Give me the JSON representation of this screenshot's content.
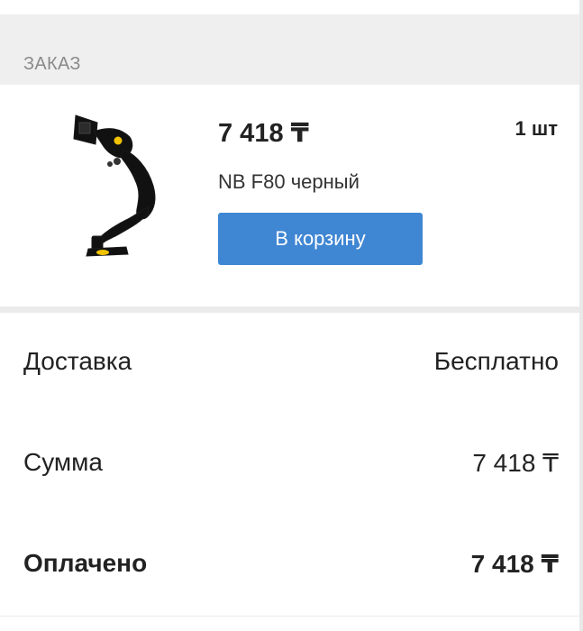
{
  "order": {
    "section_title": "ЗАКАЗ"
  },
  "product": {
    "price": "7 418 ₸",
    "quantity": "1 шт",
    "name": "NB F80 черный",
    "image_icon": "monitor-arm",
    "cart_button_label": "В корзину",
    "button_color": "#3f86d3"
  },
  "summary": {
    "delivery": {
      "label": "Доставка",
      "value": "Бесплатно"
    },
    "total": {
      "label": "Сумма",
      "value": "7 418 ₸"
    },
    "paid": {
      "label": "Оплачено",
      "value": "7 418 ₸"
    }
  }
}
